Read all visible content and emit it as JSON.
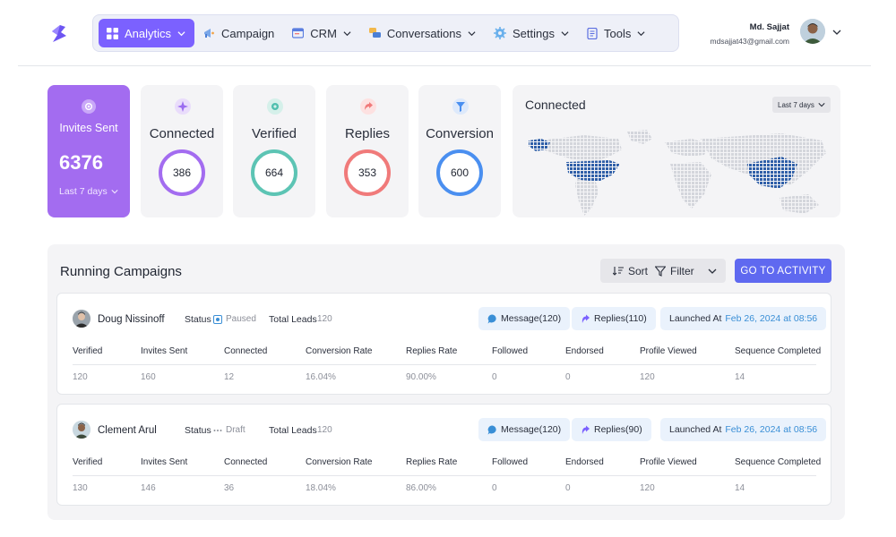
{
  "colors": {
    "accent": "#7b61ff",
    "invites_card": "#a36cf0",
    "connected_ring": "#a36cf0",
    "verified_ring": "#5cc4b4",
    "replies_ring": "#f07a7a",
    "conversion_ring": "#4a8ff0",
    "cta": "#5f69f0",
    "map_highlight": "#2f5fa8"
  },
  "nav": {
    "items": [
      {
        "label": "Analytics",
        "icon": "grid-icon",
        "dropdown": true
      },
      {
        "label": "Campaign",
        "icon": "megaphone-icon",
        "dropdown": false
      },
      {
        "label": "CRM",
        "icon": "crm-icon",
        "dropdown": true
      },
      {
        "label": "Conversations",
        "icon": "chat-icon",
        "dropdown": true
      },
      {
        "label": "Settings",
        "icon": "gear-icon",
        "dropdown": true
      },
      {
        "label": "Tools",
        "icon": "document-icon",
        "dropdown": true
      }
    ]
  },
  "user": {
    "name": "Md. Sajjat",
    "email": "mdsajjat43@gmail.com"
  },
  "stats": {
    "invites_sent": {
      "label": "Invites Sent",
      "value": "6376",
      "period": "Last 7 days"
    },
    "connected": {
      "label": "Connected",
      "value": "386"
    },
    "verified": {
      "label": "Verified",
      "value": "664"
    },
    "replies": {
      "label": "Replies",
      "value": "353"
    },
    "conversion": {
      "label": "Conversion",
      "value": "600"
    }
  },
  "map": {
    "title": "Connected",
    "range": "Last 7 days"
  },
  "campaigns": {
    "title": "Running Campaigns",
    "sort_label": "Sort",
    "filter_label": "Filter",
    "go_label": "GO TO ACTIVITY",
    "status_label": "Status",
    "total_leads_label": "Total Leads",
    "launched_label": "Launched At",
    "columns": [
      "Verified",
      "Invites Sent",
      "Connected",
      "Conversion Rate",
      "Replies Rate",
      "Followed",
      "Endorsed",
      "Profile Viewed",
      "Sequence Completed"
    ],
    "rows": [
      {
        "name": "Doug Nissinoff",
        "status": "Paused",
        "total_leads": "120",
        "message": "Message(120)",
        "replies": "Replies(110)",
        "launched": "Feb 26, 2024 at 08:56",
        "values": [
          "120",
          "160",
          "12",
          "16.04%",
          "90.00%",
          "0",
          "0",
          "120",
          "14"
        ]
      },
      {
        "name": "Clement Arul",
        "status": "Draft",
        "total_leads": "120",
        "message": "Message(120)",
        "replies": "Replies(90)",
        "launched": "Feb 26, 2024 at 08:56",
        "values": [
          "130",
          "146",
          "36",
          "18.04%",
          "86.00%",
          "0",
          "0",
          "120",
          "14"
        ]
      }
    ]
  }
}
